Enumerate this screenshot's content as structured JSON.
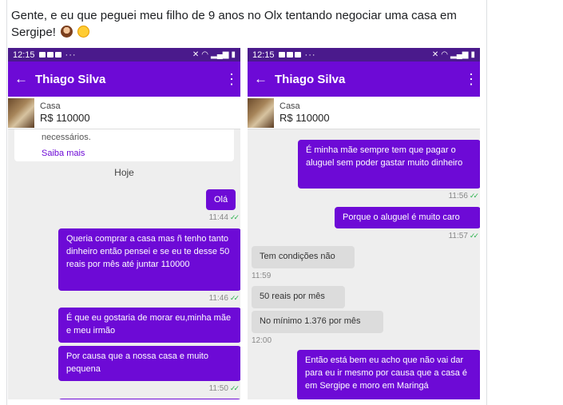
{
  "post": {
    "caption": "Gente, e eu que peguei meu filho de 9 anos no Olx tentando negociar uma casa em Sergipe!",
    "emojis": [
      "woman-facepalming-emoji",
      "rofl-emoji"
    ]
  },
  "screens": [
    {
      "status_time": "12:15",
      "contact_name": "Thiago  Silva",
      "listing": {
        "title": "Casa",
        "price": "R$ 110000"
      },
      "system_text": "necessários.",
      "system_link": "Saiba mais",
      "date_label": "Hoje",
      "messages": [
        {
          "text": "Olá",
          "time": "11:44"
        },
        {
          "text": "Queria comprar a casa mas ñ tenho tanto dinheiro então pensei e se eu te desse 50 reais por mês até juntar 110000",
          "time": "11:46"
        },
        {
          "text": "É que eu gostaria de morar eu,minha mãe e meu irmão"
        },
        {
          "text": "Por causa que a nossa casa e muito pequena",
          "time": "11:50"
        }
      ]
    },
    {
      "status_time": "12:15",
      "contact_name": "Thiago  Silva",
      "listing": {
        "title": "Casa",
        "price": "R$ 110000"
      },
      "messages": [
        {
          "text": "É minha mãe sempre tem que pagar o aluguel sem poder gastar muito dinheiro",
          "time": "11:56"
        },
        {
          "text": "Porque o aluguel é muito caro",
          "time": "11:57"
        },
        {
          "text": "Tem condições  não",
          "time": "11:59"
        },
        {
          "text": "50 reais  por mês"
        },
        {
          "text": "No mínimo  1.376 por mês",
          "time": "12:00"
        },
        {
          "text": "Então está bem eu acho que não vai dar para eu ir mesmo por causa que a casa é em Sergipe e moro em Maringá"
        }
      ]
    }
  ],
  "colors": {
    "appbar": "#6d0ad6",
    "statusbar": "#4a1a8c",
    "outgoing_bubble": "#6d0ad6",
    "incoming_bubble": "#dcdcdc",
    "read_tick": "#2bb24c"
  }
}
